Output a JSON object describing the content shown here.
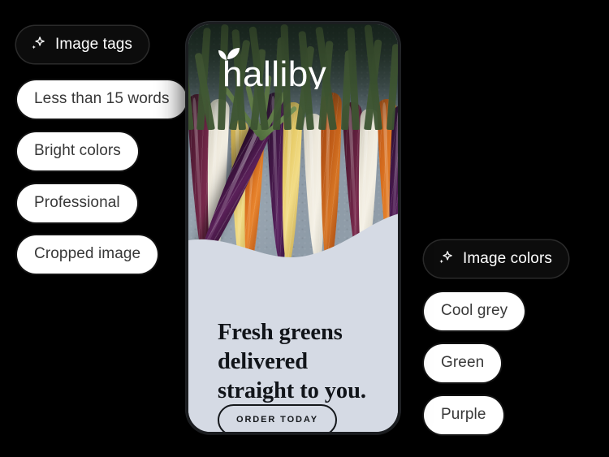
{
  "background_color": "#000000",
  "tag_groups": [
    {
      "header": {
        "label": "Image tags",
        "icon": "sparkle-icon",
        "text_color": "#ffffff",
        "bg_color": "#0c0c0c"
      },
      "items": [
        {
          "label": "Less than 15 words"
        },
        {
          "label": "Bright colors"
        },
        {
          "label": "Professional"
        },
        {
          "label": "Cropped image"
        }
      ]
    },
    {
      "header": {
        "label": "Image colors",
        "icon": "sparkle-icon",
        "text_color": "#ffffff",
        "bg_color": "#0c0c0c"
      },
      "items": [
        {
          "label": "Cool grey"
        },
        {
          "label": "Green"
        },
        {
          "label": "Purple"
        }
      ]
    }
  ],
  "phone_ad": {
    "brand": {
      "name": "halliby",
      "icon": "leaf-sprout-icon",
      "color": "#ffffff"
    },
    "image": {
      "subject": "rainbow carrots on stone slab",
      "dominant_colors": [
        "#d5dae4",
        "#4a7a3c",
        "#5a2059",
        "#d9701f",
        "#f4f0e5"
      ]
    },
    "headline": "Fresh greens delivered straight to you.",
    "headline_lines": [
      "Fresh greens",
      "delivered",
      "straight to you."
    ],
    "cta_label": "ORDER TODAY",
    "panel_color": "#d5dae4",
    "text_color": "#111419"
  }
}
